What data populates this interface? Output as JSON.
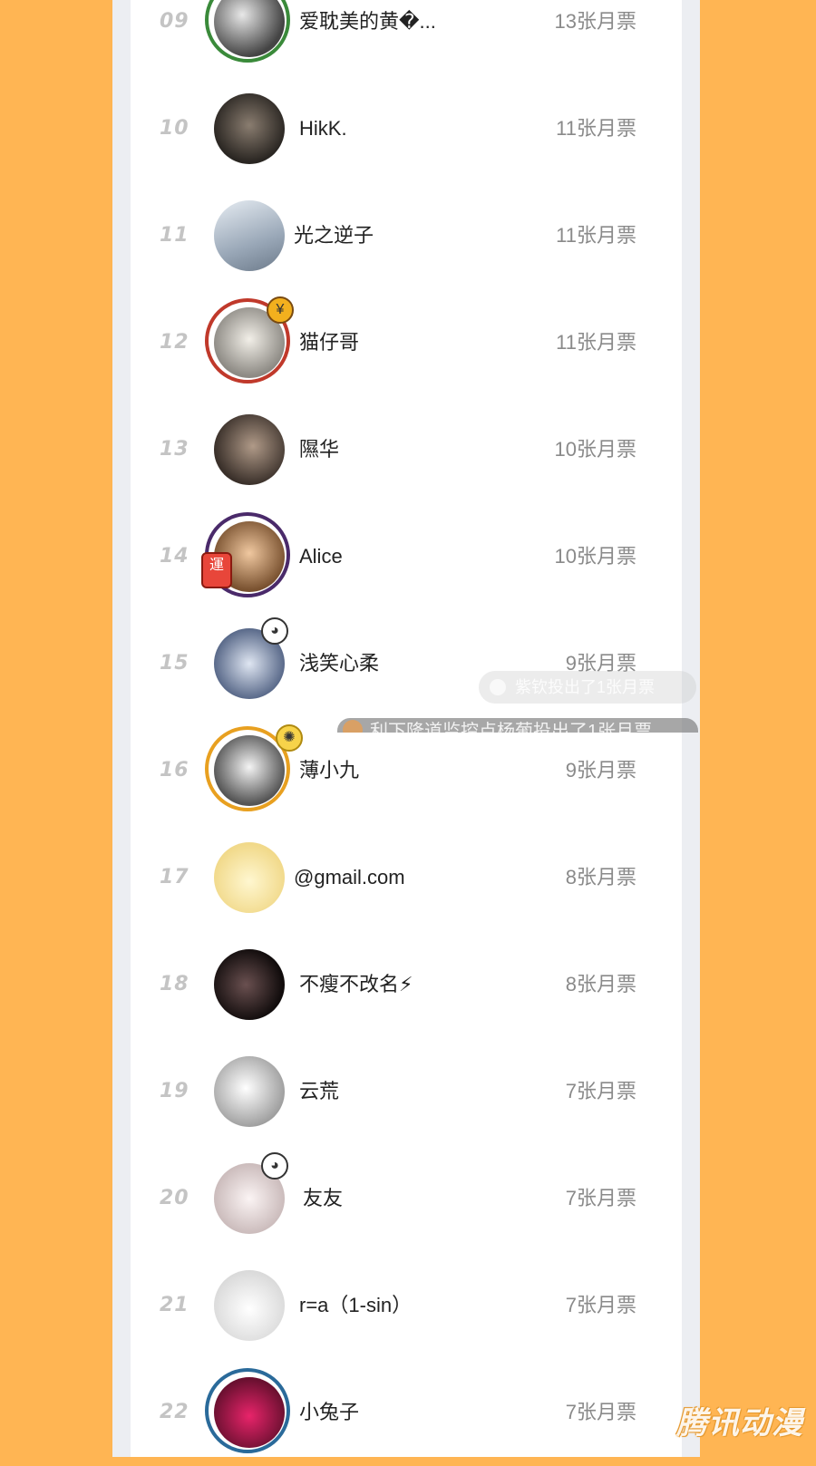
{
  "ranking": [
    {
      "rank": "09",
      "name": "爱耽美的黄�...",
      "votes": "13张月票"
    },
    {
      "rank": "10",
      "name": "HikK.",
      "votes": "11张月票"
    },
    {
      "rank": "11",
      "name": "光之逆子",
      "votes": "11张月票"
    },
    {
      "rank": "12",
      "name": "猫仔哥",
      "votes": "11张月票"
    },
    {
      "rank": "13",
      "name": "隰华",
      "votes": "10张月票"
    },
    {
      "rank": "14",
      "name": "Alice",
      "votes": "10张月票"
    },
    {
      "rank": "15",
      "name": "浅笑心柔",
      "votes": "9张月票"
    },
    {
      "rank": "16",
      "name": "薄小九",
      "votes": "9张月票"
    },
    {
      "rank": "17",
      "name": "@gmail.com",
      "votes": "8张月票"
    },
    {
      "rank": "18",
      "name": "不瘦不改名⚡",
      "votes": "8张月票"
    },
    {
      "rank": "19",
      "name": "云荒",
      "votes": "7张月票"
    },
    {
      "rank": "20",
      "name": "友友",
      "votes": "7张月票"
    },
    {
      "rank": "21",
      "name": "r=a（1-sin）",
      "votes": "7张月票"
    },
    {
      "rank": "22",
      "name": "小兔子",
      "votes": "7张月票"
    }
  ],
  "toasts": {
    "first": "紫钦投出了1张月票",
    "second": "利下隆道监控点杨葡投出了1张月票"
  },
  "watermark": "腾讯动漫",
  "colors": {
    "background": "#FFB553",
    "rank_text": "#c4c4c4",
    "name_text": "#222222",
    "votes_text": "#8a8a8a"
  }
}
